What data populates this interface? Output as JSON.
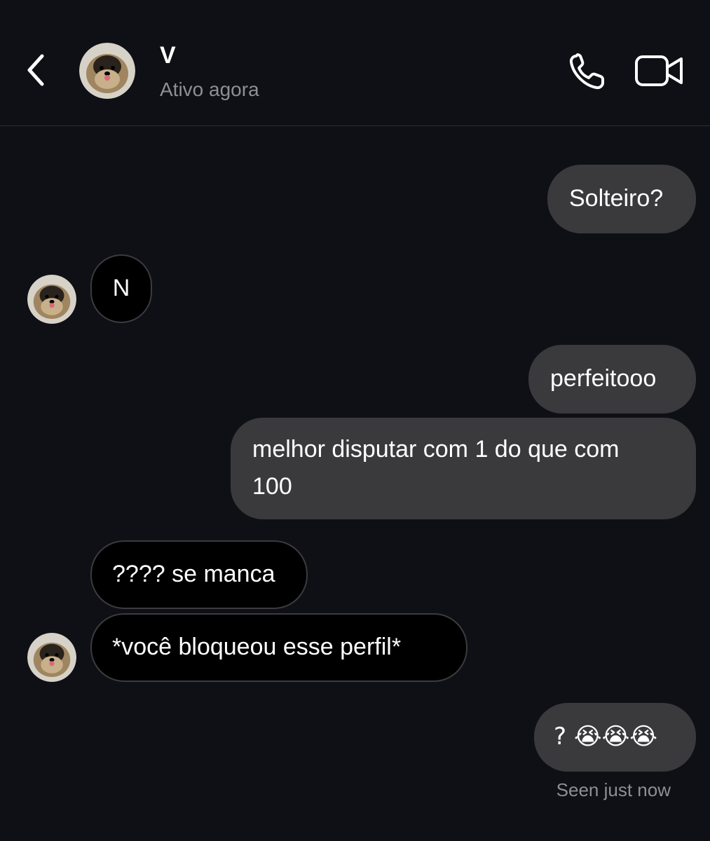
{
  "header": {
    "contact_name": "V",
    "status": "Ativo agora",
    "back_icon": "chevron-left-icon",
    "call_icon": "phone-icon",
    "video_icon": "video-camera-icon"
  },
  "messages": [
    {
      "direction": "outgoing",
      "text": "Solteiro?"
    },
    {
      "direction": "incoming",
      "text": "N"
    },
    {
      "direction": "outgoing",
      "text": "perfeitooo"
    },
    {
      "direction": "outgoing",
      "line1": "melhor disputar com 1 do que com",
      "line2": "100"
    },
    {
      "direction": "incoming",
      "text": "???? se manca"
    },
    {
      "direction": "incoming",
      "text": "*você bloqueou esse perfil*"
    },
    {
      "direction": "outgoing",
      "text": "? 😭😭😭"
    }
  ],
  "seen_status": "Seen just now",
  "colors": {
    "background": "#0f1015",
    "outgoing_bubble": "#3a3a3d",
    "incoming_bubble": "#000000",
    "secondary_text": "#8e8f95"
  }
}
